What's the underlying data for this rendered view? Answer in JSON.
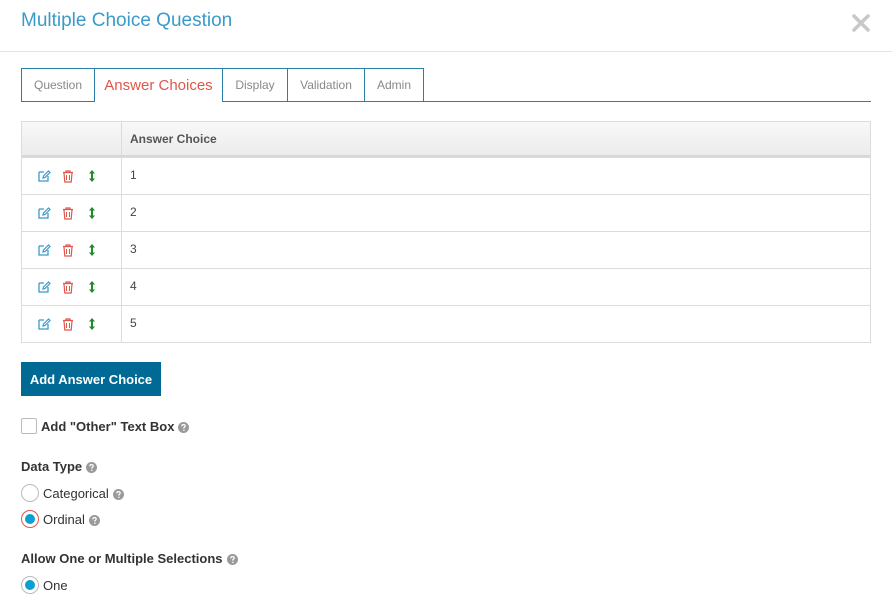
{
  "header": {
    "title": "Multiple Choice Question"
  },
  "tabs": [
    {
      "label": "Question"
    },
    {
      "label": "Answer Choices"
    },
    {
      "label": "Display"
    },
    {
      "label": "Validation"
    },
    {
      "label": "Admin"
    }
  ],
  "grid": {
    "column_header": "Answer Choice",
    "rows": [
      {
        "value": "1"
      },
      {
        "value": "2"
      },
      {
        "value": "3"
      },
      {
        "value": "4"
      },
      {
        "value": "5"
      }
    ]
  },
  "add_button_label": "Add Answer Choice",
  "other_textbox": {
    "label": "Add \"Other\" Text Box",
    "checked": false
  },
  "data_type": {
    "label": "Data Type",
    "options": [
      {
        "label": "Categorical",
        "checked": false
      },
      {
        "label": "Ordinal",
        "checked": true
      }
    ]
  },
  "selections": {
    "label": "Allow One or Multiple Selections",
    "options": [
      {
        "label": "One",
        "checked": true
      }
    ]
  },
  "colors": {
    "title": "#3a9ac9",
    "tab_border": "#2a7fa8",
    "active_tab": "#e0564a",
    "button": "#006a94",
    "edit_icon": "#3a9ac9",
    "delete_icon": "#e0564a",
    "move_icon": "#1f8a2e"
  }
}
